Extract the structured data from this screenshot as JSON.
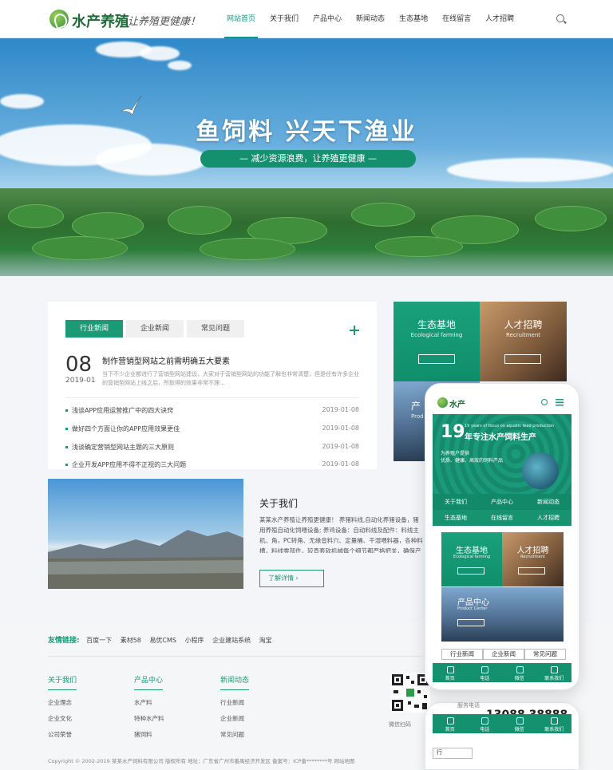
{
  "header": {
    "logo_text": "水产养殖",
    "slogan": "让养殖更健康！",
    "nav": [
      "网站首页",
      "关于我们",
      "产品中心",
      "新闻动态",
      "生态基地",
      "在线留言",
      "人才招聘"
    ],
    "active_nav": "网站首页"
  },
  "banner": {
    "title": "鱼饲料  兴天下渔业",
    "pill": "— 减少资源浪费，让养殖更健康 —"
  },
  "news": {
    "tabs": [
      "行业新闻",
      "企业新闻",
      "常见问题"
    ],
    "active_tab": "行业新闻",
    "featured": {
      "day": "08",
      "year_month": "2019-01",
      "title": "制作营销型网站之前需明确五大要素",
      "excerpt": "当下不少企业都进行了营销型网站建设，大家对于营销型网站的功能了解也非常清楚，但是任有许多企业的营销型网站上线之后，所取得的效果非常不理..."
    },
    "items": [
      {
        "title": "浅谈APP应用运营推广中的四大诀窍",
        "date": "2019-01-08"
      },
      {
        "title": "做好四个方面让你的APP应用效果更佳",
        "date": "2019-01-08"
      },
      {
        "title": "浅谈确定营销型网站主题的三大原则",
        "date": "2019-01-08"
      },
      {
        "title": "企业开发APP应用不得不正视的三大问题",
        "date": "2019-01-08"
      }
    ]
  },
  "tiles": {
    "eco": {
      "title": "生态基地",
      "sub": "Ecological farming"
    },
    "talent": {
      "title": "人才招聘",
      "sub": "Recruitment"
    },
    "product": {
      "title": "产",
      "sub": "Prod"
    }
  },
  "about": {
    "title": "关于我们",
    "text": "某某水产养殖让养殖更健康！ 养猪料线,自动化养猪设备，猪用养殖自动化饲喂设备; 养鸡设备：自动料线及配件：料线主机、角，PC转角、无缘音料穴、定量桶、干湿喂料器，各种料槽，料线零部件，较直套软机械每个细节都严格把关，确保产品质",
    "more": "了解详情  ›"
  },
  "footer": {
    "links_title": "友情链接:",
    "links": [
      "百度一下",
      "素材58",
      "易优CMS",
      "小程序",
      "企业建站系统",
      "淘宝"
    ],
    "cols": [
      {
        "title": "关于我们",
        "items": [
          "企业理念",
          "企业文化",
          "公司荣誉"
        ]
      },
      {
        "title": "产品中心",
        "items": [
          "水产料",
          "特种水产料",
          "猪饲料"
        ]
      },
      {
        "title": "新闻动态",
        "items": [
          "行业新闻",
          "企业新闻",
          "常见问题"
        ]
      }
    ],
    "qr_caption": "微信扫码",
    "copyright": "Copyright © 2002-2019 某某水产饲料有限公司 版权所有  地址：广东省广州市番禺经济开发区  备案号：ICP备********号  网站地图"
  },
  "phone": {
    "logo_text": "水产",
    "hero_number": "19",
    "hero_line1": "19 years of focus on aquatic feed production",
    "hero_title": "年专注水产饲料生产",
    "hero_sub1": "为养殖户提供",
    "hero_sub2": "优质、健康、高效的饲料产品",
    "grid": [
      "关于我们",
      "产品中心",
      "新闻动态",
      "生态基地",
      "在线留言",
      "人才招聘"
    ],
    "eco": {
      "title": "生态基地",
      "sub": "Ecological farming"
    },
    "talent": {
      "title": "人才招聘",
      "sub": "Recruitment"
    },
    "product": {
      "title": "产品中心",
      "sub": "Product Center"
    },
    "tabs": [
      "行业新闻",
      "企业新闻",
      "常见问题"
    ],
    "bottom_nav": [
      "首页",
      "电话",
      "微信",
      "联系我们"
    ],
    "behind_phone_label": "服务电话",
    "behind_phone_number": "13088 38888",
    "behind_tab": "行"
  }
}
